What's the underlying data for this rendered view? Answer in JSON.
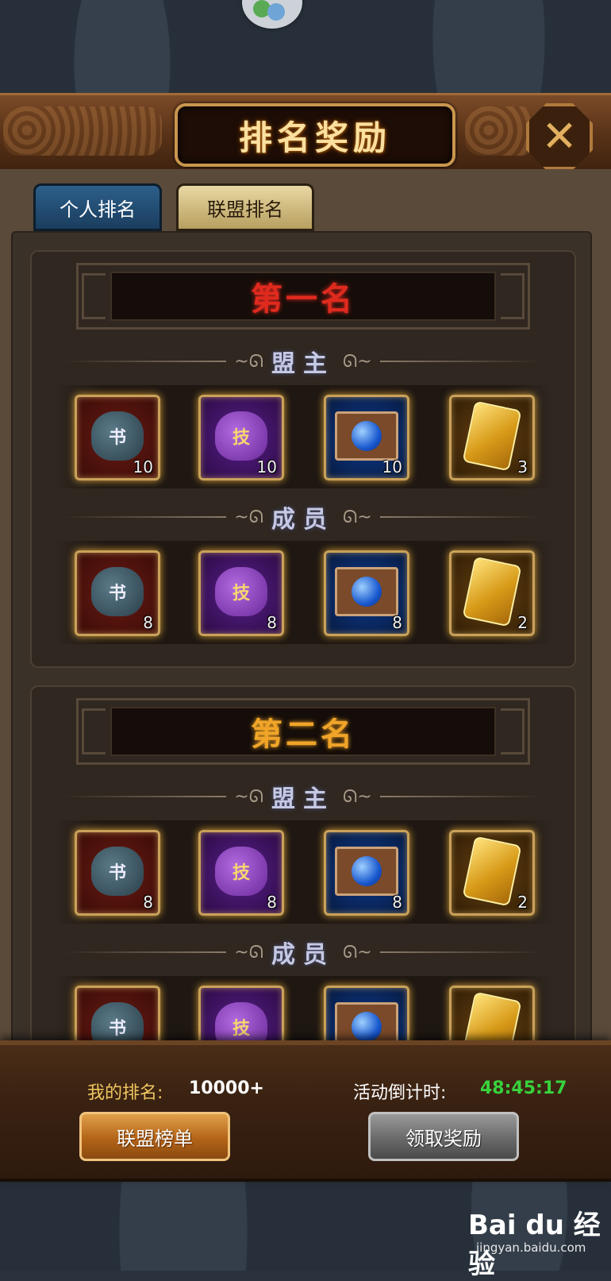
{
  "header": {
    "title": "排名奖励"
  },
  "tabs": [
    {
      "label": "个人排名",
      "active": false
    },
    {
      "label": "联盟排名",
      "active": true
    }
  ],
  "ranks": [
    {
      "name": "第一名",
      "name_color": "#e02a1e",
      "sections": [
        {
          "label": "盟主",
          "items": [
            {
              "type": "book-bag",
              "glyph": "书",
              "count": "10"
            },
            {
              "type": "skill-bag",
              "glyph": "技",
              "count": "10"
            },
            {
              "type": "orb-chest",
              "count": "10"
            },
            {
              "type": "gold-token",
              "count": "3"
            }
          ]
        },
        {
          "label": "成员",
          "items": [
            {
              "type": "book-bag",
              "glyph": "书",
              "count": "8"
            },
            {
              "type": "skill-bag",
              "glyph": "技",
              "count": "8"
            },
            {
              "type": "orb-chest",
              "count": "8"
            },
            {
              "type": "gold-token",
              "count": "2"
            }
          ]
        }
      ]
    },
    {
      "name": "第二名",
      "name_color": "#f0a428",
      "sections": [
        {
          "label": "盟主",
          "items": [
            {
              "type": "book-bag",
              "glyph": "书",
              "count": "8"
            },
            {
              "type": "skill-bag",
              "glyph": "技",
              "count": "8"
            },
            {
              "type": "orb-chest",
              "count": "8"
            },
            {
              "type": "gold-token",
              "count": "2"
            }
          ]
        },
        {
          "label": "成员",
          "items": [
            {
              "type": "book-bag",
              "glyph": "书",
              "count": ""
            },
            {
              "type": "skill-bag",
              "glyph": "技",
              "count": ""
            },
            {
              "type": "orb-chest",
              "count": ""
            },
            {
              "type": "gold-token",
              "count": ""
            }
          ]
        }
      ]
    }
  ],
  "footer": {
    "my_rank_label": "我的排名:",
    "my_rank_value": "10000+",
    "countdown_label": "活动倒计时:",
    "countdown_value": "48:45:17",
    "alliance_list_button": "联盟榜单",
    "claim_button": "领取奖励"
  },
  "watermark": {
    "brand": "Bai du 经验",
    "url": "jingyan.baidu.com"
  }
}
